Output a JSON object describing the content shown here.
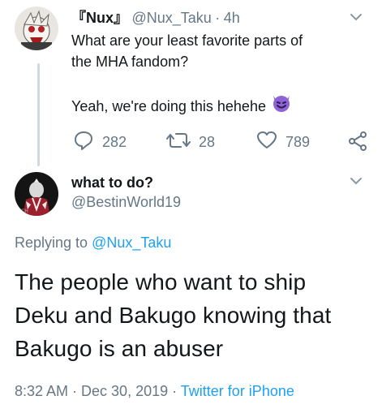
{
  "original_tweet": {
    "display_name": "『Nux』",
    "handle": "@Nux_Taku",
    "time": "4h",
    "text_line1": "What are your least favorite parts of",
    "text_line2": "the MHA fandom?",
    "text_line3": "Yeah, we're doing this hehehe",
    "emoji": "😈",
    "reply_count": "282",
    "retweet_count": "28",
    "like_count": "789"
  },
  "reply_tweet": {
    "display_name": "what to do?",
    "handle": "@BestinWorld19",
    "replying_prefix": "Replying to",
    "replying_handle": "@Nux_Taku",
    "text_line1": "The people who want to ship",
    "text_line2": "Deku and Bakugo knowing that",
    "text_line3": "Bakugo is an abuser",
    "timestamp": "8:32 AM · Dec 30, 2019 ·",
    "client": "Twitter for iPhone"
  },
  "colors": {
    "text": "#14171a",
    "muted": "#657786",
    "link": "#1da1f2",
    "thread_line": "#cfd9de"
  },
  "icons": {
    "reply": "reply-icon",
    "retweet": "retweet-icon",
    "like": "heart-icon",
    "share": "share-icon",
    "more": "chevron-down-icon"
  }
}
